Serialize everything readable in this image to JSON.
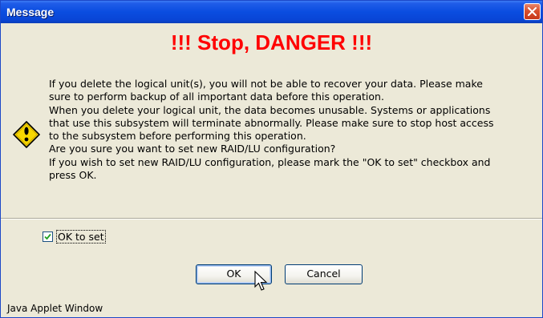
{
  "window": {
    "title": "Message",
    "close_icon": "close-icon",
    "accent_color": "#0a4de0"
  },
  "dialog": {
    "heading": "!!! Stop, DANGER !!!",
    "heading_color": "#ff0000",
    "icon": "warning-icon",
    "message_lines": [
      "If you delete the logical unit(s), you will not be able to recover your data. Please make",
      "sure to perform backup of all important data before this operation.",
      "When you delete your logical unit, the data becomes unusable. Systems or applications",
      "that use this subsystem will terminate abnormally. Please make sure to stop host access",
      "to the subsystem before performing this operation.",
      "Are you sure you want to set new RAID/LU configuration?",
      "If you wish to set new RAID/LU configuration, please mark the \"OK to set\" checkbox and",
      "press OK."
    ]
  },
  "confirm": {
    "checkbox_label": "OK to set",
    "checked": true
  },
  "buttons": {
    "ok_label": "OK",
    "cancel_label": "Cancel"
  },
  "status_bar": {
    "text": "Java Applet Window"
  }
}
